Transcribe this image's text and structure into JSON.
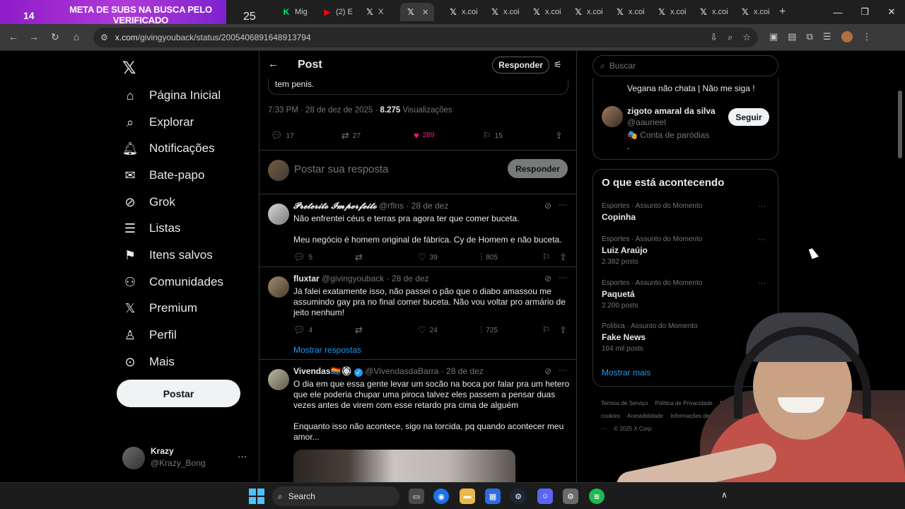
{
  "browser": {
    "banner": {
      "number": "14",
      "text": "META DE SUBS NA BUSCA PELO VERIFICADO",
      "counter": "25"
    },
    "tabs": [
      {
        "icon": "green-k-icon",
        "label": "Mig"
      },
      {
        "icon": "youtube-icon",
        "label": "(2) E"
      },
      {
        "icon": "x-logo-icon",
        "label": "X"
      },
      {
        "icon": "x-logo-icon",
        "label": "",
        "active": true
      },
      {
        "icon": "x-logo-icon",
        "label": "x.coi"
      },
      {
        "icon": "x-logo-icon",
        "label": "x.coi"
      },
      {
        "icon": "x-logo-icon",
        "label": "x.coi"
      },
      {
        "icon": "x-logo-icon",
        "label": "x.coi"
      },
      {
        "icon": "x-logo-icon",
        "label": "x.coi"
      },
      {
        "icon": "x-logo-icon",
        "label": "x.coi"
      },
      {
        "icon": "x-logo-icon",
        "label": "x.coi"
      },
      {
        "icon": "x-logo-icon",
        "label": "x.coi"
      }
    ],
    "url_host": "x.com",
    "url_path": "/givingyouback/status/2005406891648913794"
  },
  "sidebar": {
    "items": [
      {
        "label": "Página Inicial",
        "icon": "home-icon"
      },
      {
        "label": "Explorar",
        "icon": "search-icon"
      },
      {
        "label": "Notificações",
        "icon": "bell-icon"
      },
      {
        "label": "Bate-papo",
        "icon": "mail-icon"
      },
      {
        "label": "Grok",
        "icon": "grok-icon"
      },
      {
        "label": "Listas",
        "icon": "list-icon"
      },
      {
        "label": "Itens salvos",
        "icon": "bookmark-icon"
      },
      {
        "label": "Comunidades",
        "icon": "people-icon"
      },
      {
        "label": "Premium",
        "icon": "x-logo-icon"
      },
      {
        "label": "Perfil",
        "icon": "person-icon"
      },
      {
        "label": "Mais",
        "icon": "more-circle-icon"
      }
    ],
    "post_button": "Postar",
    "profile": {
      "name": "Krazy",
      "handle": "@Krazy_Bong"
    }
  },
  "main": {
    "header_title": "Post",
    "reply_button": "Responder",
    "quoted_tail": "tem penis.",
    "meta_time": "7:33 PM · 28 de dez de 2025 · ",
    "meta_views": "8.275",
    "meta_views_label": " Visualizações",
    "stats": {
      "replies": "17",
      "reposts": "27",
      "likes": "289",
      "bookmarks": "15"
    },
    "reply_placeholder": "Postar sua resposta",
    "reply_submit": "Responder",
    "tweets": [
      {
        "name": "𝓟𝓻𝓮𝓽𝓮𝓻𝓲𝓽𝓸 𝓘𝓶𝓹𝓮𝓻𝓯𝓮𝓲𝓽𝓸",
        "handle": "@rflns",
        "date": "28 de dez",
        "text1": "Não enfrentei céus e terras pra agora ter que comer buceta.",
        "text2": "Meu negócio é homem original de fábrica. Cy de Homem e não buceta.",
        "replies": "5",
        "reposts": "",
        "likes": "39",
        "views": "805"
      },
      {
        "name": "fluxtar",
        "handle": "@givingyouback",
        "date": "28 de dez",
        "text1": "Já falei exatamente isso, não passei o pão que o diabo amassou me assumindo gay pra no final comer buceta. Não vou voltar pro armário de jeito nenhum!",
        "replies": "4",
        "reposts": "",
        "likes": "24",
        "views": "725",
        "show_replies": "Mostrar respostas"
      },
      {
        "name": "Vivendas🏳️‍🌈🏵",
        "handle": "@VivendasdaBarra",
        "date": "28 de dez",
        "text1": "O dia em que essa gente levar um socão na boca por falar pra um hetero que ele poderia chupar uma piroca talvez eles passem a pensar duas vezes antes de virem com esse retardo pra cima de alguém",
        "text2": "Enquanto isso não acontece, sigo na torcida, pq quando acontecer meu amor..."
      }
    ]
  },
  "right": {
    "search_placeholder": "Buscar",
    "who": {
      "bio_top": "Vegana não chata | Não me siga !",
      "name": "zigoto amaral da silva",
      "handle": "@aaurieel",
      "parody": "🎭 Conta de paródias",
      "dot": ".",
      "follow": "Seguir"
    },
    "trends_title": "O que está acontecendo",
    "trends": [
      {
        "context": "Esportes · Assunto do Momento",
        "title": "Copinha",
        "count": ""
      },
      {
        "context": "Esportes · Assunto do Momento",
        "title": "Luiz Araújo",
        "count": "2.382 posts"
      },
      {
        "context": "Esportes · Assunto do Momento",
        "title": "Paquetá",
        "count": "2.200 posts"
      },
      {
        "context": "Política · Assunto do Momento",
        "title": "Fake News",
        "count": "104 mil posts"
      }
    ],
    "show_more": "Mostrar mais",
    "footer": [
      "Termos de Serviço",
      "Política de Privacidade",
      "Política de cookies",
      "Acessibilidade",
      "Informações de anúncios",
      "Mais ···",
      "© 2025 X Corp."
    ]
  },
  "taskbar": {
    "search_label": "Search"
  },
  "colors": {
    "accent": "#1d9bf0",
    "like": "#f91880",
    "banner": "#a433d6"
  }
}
